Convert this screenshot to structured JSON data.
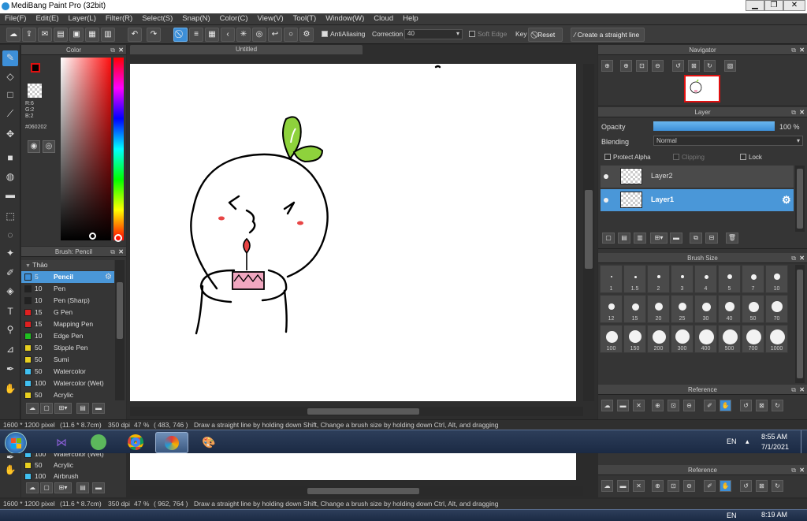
{
  "window": {
    "title": "MediBang Paint Pro (32bit)",
    "minimize": "▁",
    "maximize": "❐",
    "close": "✕"
  },
  "menu": [
    "File(F)",
    "Edit(E)",
    "Layer(L)",
    "Filter(R)",
    "Select(S)",
    "Snap(N)",
    "Color(C)",
    "View(V)",
    "Tool(T)",
    "Window(W)",
    "Cloud",
    "Help"
  ],
  "toolbar": {
    "antialiasing_label": "AntiAliasing",
    "correction_label": "Correction",
    "correction_value": "40",
    "soft_edge_label": "Soft Edge",
    "key_label": "Key",
    "reset_label": "Reset",
    "straight_line_label": "Create a straight line"
  },
  "color_panel": {
    "title": "Color",
    "r": "R:6",
    "g": "G:2",
    "b": "B:2",
    "hex": "#060202",
    "fg_color": "#e01010",
    "bg_color": "#ffffff"
  },
  "brush_panel": {
    "title": "Brush: Pencil",
    "group": "Thảo",
    "items": [
      {
        "size": "5",
        "name": "Pencil",
        "color": "#3d8fd8",
        "selected": true
      },
      {
        "size": "10",
        "name": "Pen",
        "color": "#222222"
      },
      {
        "size": "10",
        "name": "Pen (Sharp)",
        "color": "#222222"
      },
      {
        "size": "15",
        "name": "G Pen",
        "color": "#e02020"
      },
      {
        "size": "15",
        "name": "Mapping Pen",
        "color": "#e02020"
      },
      {
        "size": "10",
        "name": "Edge Pen",
        "color": "#20c020"
      },
      {
        "size": "50",
        "name": "Stipple Pen",
        "color": "#e8d020"
      },
      {
        "size": "50",
        "name": "Sumi",
        "color": "#e8d020"
      },
      {
        "size": "50",
        "name": "Watercolor",
        "color": "#40c0f0"
      },
      {
        "size": "100",
        "name": "Watercolor (Wet)",
        "color": "#40c0f0"
      },
      {
        "size": "50",
        "name": "Acrylic",
        "color": "#e8d020"
      }
    ]
  },
  "document": {
    "tab_title": "Untitled"
  },
  "navigator": {
    "title": "Navigator"
  },
  "layer_panel": {
    "title": "Layer",
    "opacity_label": "Opacity",
    "opacity_value": "100 %",
    "opacity_fraction": 1.0,
    "blending_label": "Blending",
    "blending_value": "Normal",
    "protect_alpha": "Protect Alpha",
    "clipping": "Clipping",
    "lock": "Lock",
    "layers": [
      {
        "name": "Layer2",
        "selected": false
      },
      {
        "name": "Layer1",
        "selected": true
      }
    ]
  },
  "brush_size_panel": {
    "title": "Brush Size",
    "sizes": [
      "1",
      "1.5",
      "2",
      "3",
      "4",
      "5",
      "7",
      "10",
      "12",
      "15",
      "20",
      "25",
      "30",
      "40",
      "50",
      "70",
      "100",
      "150",
      "200",
      "300",
      "400",
      "500",
      "700",
      "1000"
    ]
  },
  "reference_panel": {
    "title": "Reference"
  },
  "statusbar": {
    "size": "1600 * 1200 pixel",
    "cm": "(11.6 * 8.7cm)",
    "dpi": "350 dpi",
    "zoom": "47 %",
    "coords": "( 483, 746 )",
    "hint": "Draw a straight line by holding down Shift, Change a brush size by holding down Ctrl, Alt, and dragging"
  },
  "taskbar": {
    "lang": "EN",
    "time": "8:55 AM",
    "date": "7/1/2021"
  },
  "duplicate": {
    "brush_items": [
      {
        "size": "100",
        "name": "Watercolor (Wet)",
        "color": "#40c0f0"
      },
      {
        "size": "50",
        "name": "Acrylic",
        "color": "#e8d020"
      },
      {
        "size": "100",
        "name": "Airbrush",
        "color": "#40c0f0"
      }
    ],
    "reference_title": "Reference",
    "status_coords": "( 962, 764 )",
    "time": "8:19 AM"
  }
}
